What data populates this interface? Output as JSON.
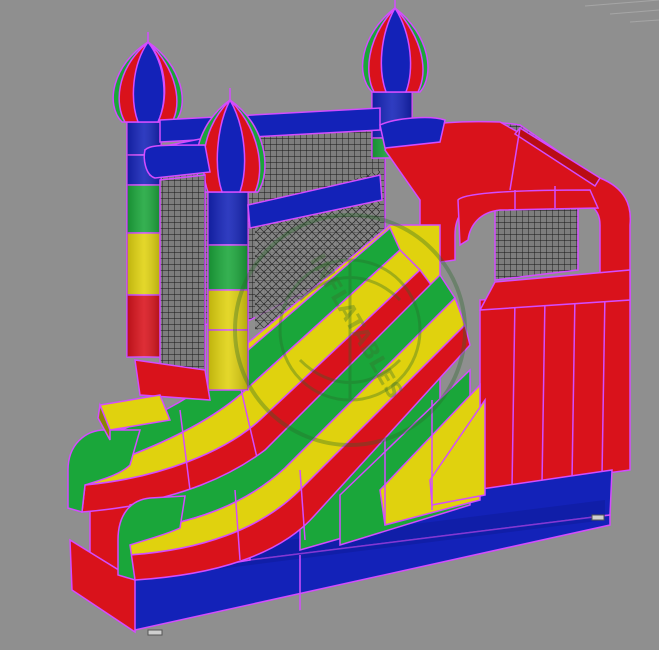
{
  "scene": {
    "subject": "inflatable-castle-bounce-house-with-double-slide",
    "render_mode": "3d-wireframe-shaded",
    "watermark_text": "INFLATABLES",
    "colors": {
      "viewport_bg": "#8f8f8f",
      "red": "#d9121b",
      "dark_red": "#b90d15",
      "blue": "#1322b8",
      "dark_blue": "#0d1890",
      "green": "#1aa63a",
      "yellow": "#e0d20e",
      "edge": "#d34cff",
      "mesh": "#151515"
    }
  }
}
